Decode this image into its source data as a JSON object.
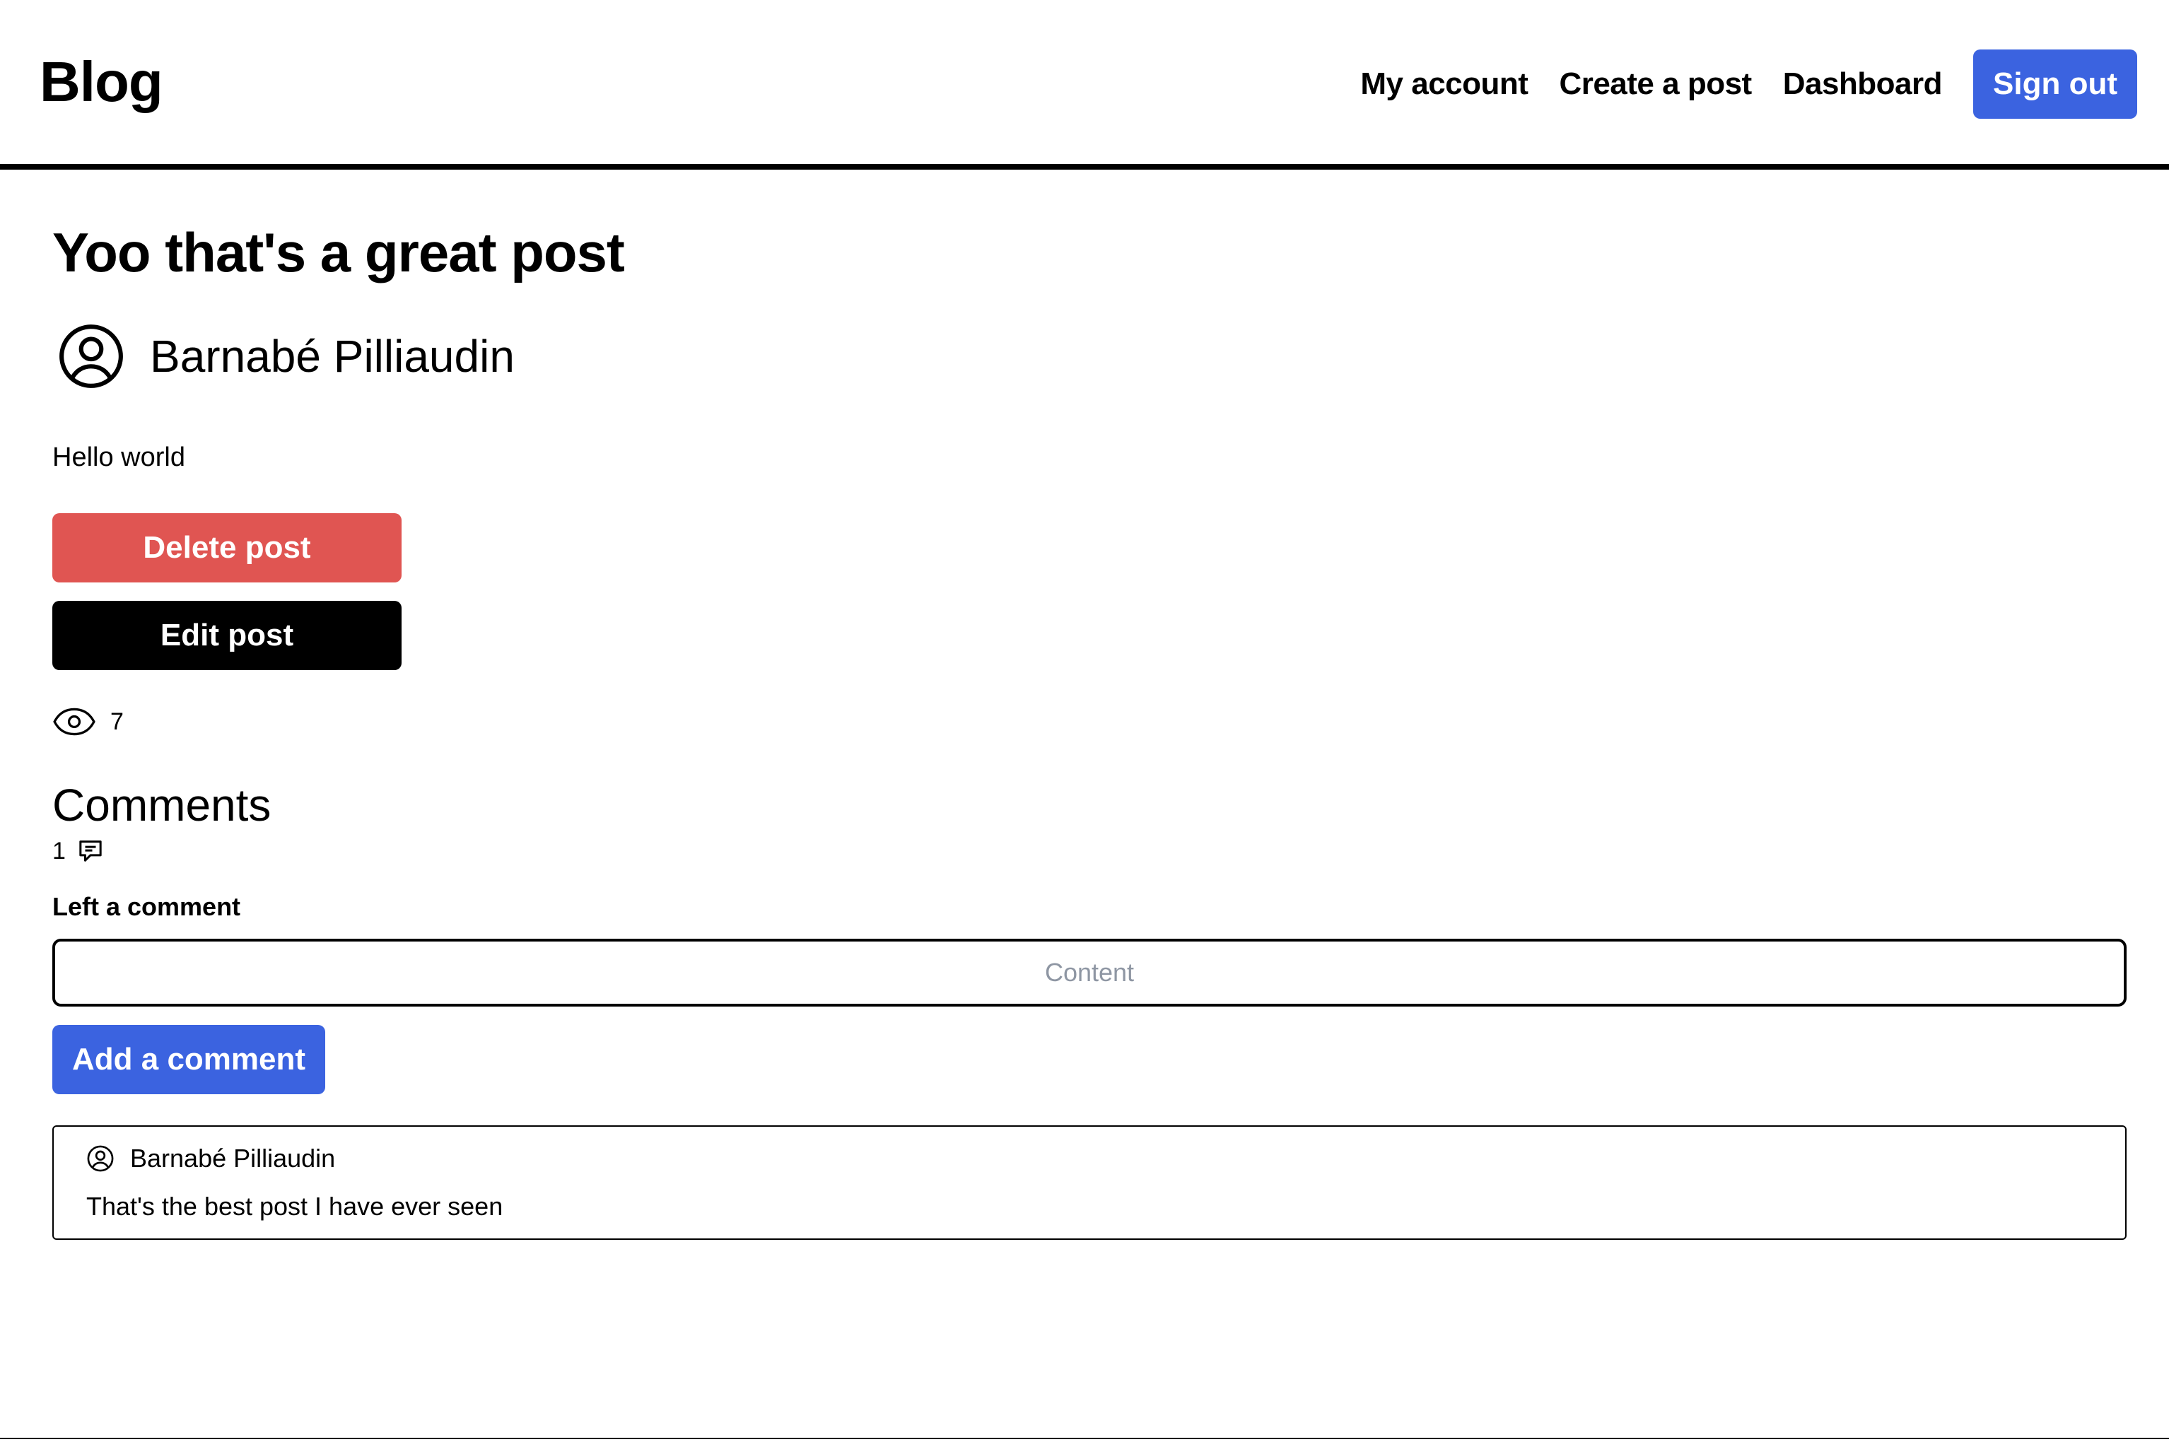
{
  "header": {
    "brand": "Blog",
    "nav": [
      {
        "label": "My account"
      },
      {
        "label": "Create a post"
      },
      {
        "label": "Dashboard"
      }
    ],
    "sign_out_label": "Sign out",
    "accent_color": "#3b63e0"
  },
  "post": {
    "title": "Yoo that's a great post",
    "author": "Barnabé Pilliaudin",
    "body": "Hello world",
    "delete_label": "Delete post",
    "edit_label": "Edit post",
    "views": "7",
    "delete_color": "#e05552"
  },
  "comments": {
    "title": "Comments",
    "count": "1",
    "form_label": "Left a comment",
    "input_placeholder": "Content",
    "input_value": "",
    "add_label": "Add a comment",
    "items": [
      {
        "author": "Barnabé Pilliaudin",
        "text": "That's the best post I have ever seen"
      }
    ]
  },
  "icons": {
    "author_avatar": "user-circle-icon",
    "views": "eye-icon",
    "comments": "chat-bubble-icon"
  }
}
